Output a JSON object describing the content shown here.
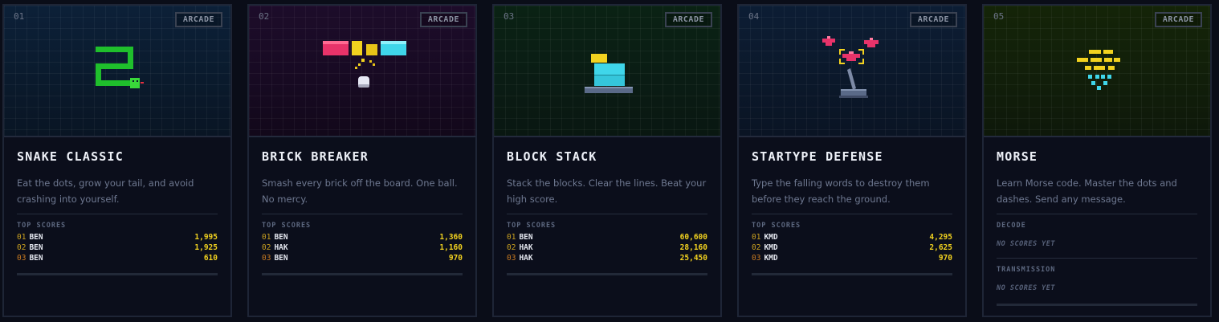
{
  "badge": "ARCADE",
  "top_scores_label": "TOP SCORES",
  "games": [
    {
      "number": "01",
      "title": "SNAKE CLASSIC",
      "description": "Eat the dots, grow your tail, and avoid crashing into yourself.",
      "scores": [
        {
          "rank": "01",
          "name": "BEN",
          "score": "1,995"
        },
        {
          "rank": "02",
          "name": "BEN",
          "score": "1,925"
        },
        {
          "rank": "03",
          "name": "BEN",
          "score": "610"
        }
      ]
    },
    {
      "number": "02",
      "title": "BRICK BREAKER",
      "description": "Smash every brick off the board. One ball. No mercy.",
      "scores": [
        {
          "rank": "01",
          "name": "BEN",
          "score": "1,360"
        },
        {
          "rank": "02",
          "name": "HAK",
          "score": "1,160"
        },
        {
          "rank": "03",
          "name": "BEN",
          "score": "970"
        }
      ]
    },
    {
      "number": "03",
      "title": "BLOCK STACK",
      "description": "Stack the blocks. Clear the lines. Beat your high score.",
      "scores": [
        {
          "rank": "01",
          "name": "BEN",
          "score": "60,600"
        },
        {
          "rank": "02",
          "name": "HAK",
          "score": "28,160"
        },
        {
          "rank": "03",
          "name": "HAK",
          "score": "25,450"
        }
      ]
    },
    {
      "number": "04",
      "title": "STARTYPE DEFENSE",
      "description": "Type the falling words to destroy them before they reach the ground.",
      "scores": [
        {
          "rank": "01",
          "name": "KMD",
          "score": "4,295"
        },
        {
          "rank": "02",
          "name": "KMD",
          "score": "2,625"
        },
        {
          "rank": "03",
          "name": "KMD",
          "score": "970"
        }
      ]
    },
    {
      "number": "05",
      "title": "MORSE",
      "description": "Learn Morse code. Master the dots and dashes. Send any message.",
      "sections": [
        {
          "label": "DECODE",
          "empty_text": "NO SCORES YET"
        },
        {
          "label": "TRANSMISSION",
          "empty_text": "NO SCORES YET"
        }
      ]
    }
  ]
}
